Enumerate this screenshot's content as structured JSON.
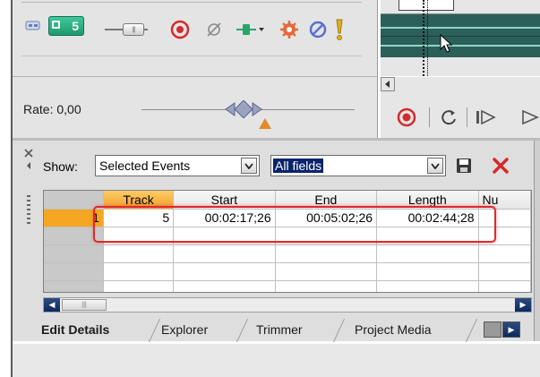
{
  "track_header": {
    "track_number": "5"
  },
  "rate": {
    "label": "Rate: 0,00"
  },
  "event_list": {
    "show_label": "Show:",
    "show_value": "Selected Events",
    "fields_value": "All fields",
    "columns": [
      "Track",
      "Start",
      "End",
      "Length",
      "Nu"
    ],
    "rows": [
      {
        "row_number": "1",
        "track": "5",
        "start": "00:02:17;26",
        "end": "00:05:02;26",
        "length": "00:02:44;28"
      }
    ]
  },
  "tabs": [
    "Edit Details",
    "Explorer",
    "Trimmer",
    "Project Media"
  ],
  "colors": {
    "highlight": "#e0282d",
    "active_row": "#f5a623",
    "track_header": "#2fb584",
    "selection": "#0a246a"
  }
}
